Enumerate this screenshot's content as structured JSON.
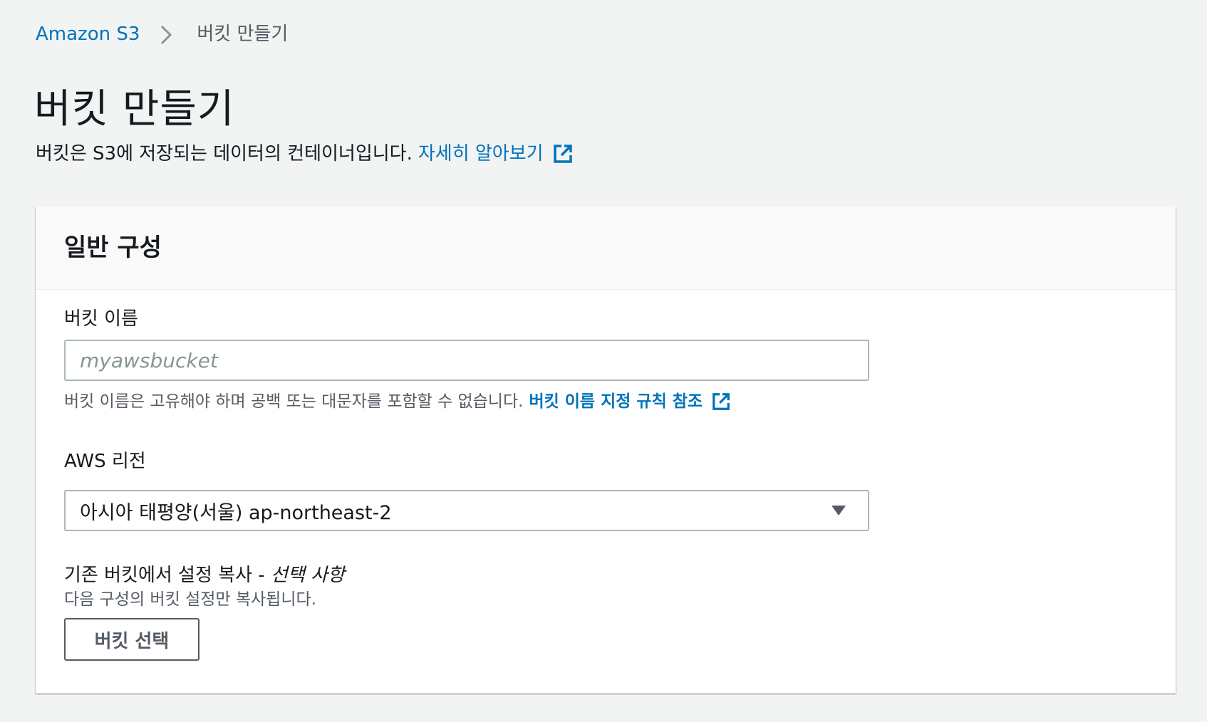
{
  "breadcrumb": {
    "root": "Amazon S3",
    "current": "버킷 만들기"
  },
  "page": {
    "title": "버킷 만들기",
    "description": "버킷은 S3에 저장되는 데이터의 컨테이너입니다.",
    "learn_more": "자세히 알아보기"
  },
  "general_config": {
    "title": "일반 구성",
    "bucket_name": {
      "label": "버킷 이름",
      "placeholder": "myawsbucket",
      "value": "",
      "hint": "버킷 이름은 고유해야 하며 공백 또는 대문자를 포함할 수 없습니다.",
      "rules_link": "버킷 이름 지정 규칙 참조"
    },
    "region": {
      "label": "AWS 리전",
      "selected": "아시아 태평양(서울) ap-northeast-2"
    },
    "copy_settings": {
      "label": "기존 버킷에서 설정 복사 - ",
      "optional": "선택 사항",
      "description": "다음 구성의 버킷 설정만 복사됩니다.",
      "button": "버킷 선택"
    }
  },
  "colors": {
    "link": "#0073bb",
    "background": "#f2f3f3",
    "text": "#16191f",
    "secondary_text": "#545b64"
  },
  "icons": {
    "breadcrumb_separator": "chevron-right-icon",
    "external_link": "external-link-icon",
    "dropdown": "caret-down-icon"
  }
}
